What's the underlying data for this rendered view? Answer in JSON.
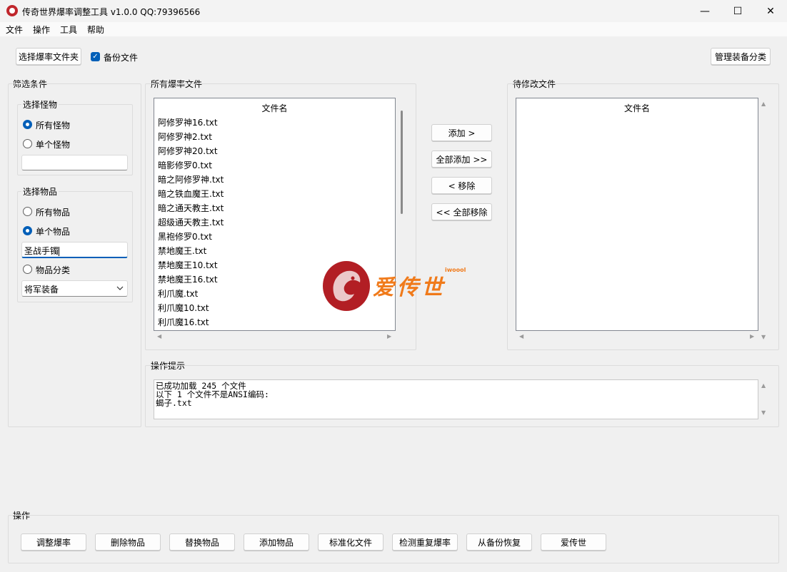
{
  "window": {
    "title": "传奇世界爆率调整工具 v1.0.0 QQ:79396566",
    "minimize": "—",
    "maximize": "☐",
    "close": "✕"
  },
  "menu": [
    "文件",
    "操作",
    "工具",
    "帮助"
  ],
  "toolbar": {
    "select_folder": "选择爆率文件夹",
    "backup_label": "备份文件",
    "backup_checked": true,
    "manage_equipment": "管理装备分类"
  },
  "filter": {
    "title": "筛选条件",
    "monster_group": "选择怪物",
    "monster_options": [
      "所有怪物",
      "单个怪物"
    ],
    "monster_selected": 0,
    "monster_input": "",
    "item_group": "选择物品",
    "item_options": [
      "所有物品",
      "单个物品",
      "物品分类"
    ],
    "item_selected": 1,
    "item_input": "圣战手镯",
    "category_value": "将军装备"
  },
  "all_files": {
    "title": "所有爆率文件",
    "header": "文件名",
    "files": [
      "阿修罗神16.txt",
      "阿修罗神2.txt",
      "阿修罗神20.txt",
      "暗影修罗0.txt",
      "暗之阿修罗神.txt",
      "暗之铁血魔王.txt",
      "暗之通天教主.txt",
      "超级通天教主.txt",
      "黑袍修罗0.txt",
      "禁地魔王.txt",
      "禁地魔王10.txt",
      "禁地魔王16.txt",
      "利爪魔.txt",
      "利爪魔10.txt",
      "利爪魔16.txt"
    ]
  },
  "actions": {
    "add": "添加 >",
    "add_all": "全部添加 >>",
    "remove": "< 移除",
    "remove_all": "<< 全部移除"
  },
  "pending": {
    "title": "待修改文件",
    "header": "文件名"
  },
  "log": {
    "title": "操作提示",
    "lines": "已成功加载 245 个文件\n以下 1 个文件不是ANSI编码:\n蝎子.txt"
  },
  "operations": {
    "title": "操作",
    "buttons": [
      "调整爆率",
      "删除物品",
      "替换物品",
      "添加物品",
      "标准化文件",
      "检测重复爆率",
      "从备份恢复",
      "爱传世"
    ]
  },
  "watermark": {
    "text": "爱传世",
    "tag": "iwoool",
    "colors": {
      "primary": "#f07a1a",
      "logo": "#b21e24"
    }
  }
}
